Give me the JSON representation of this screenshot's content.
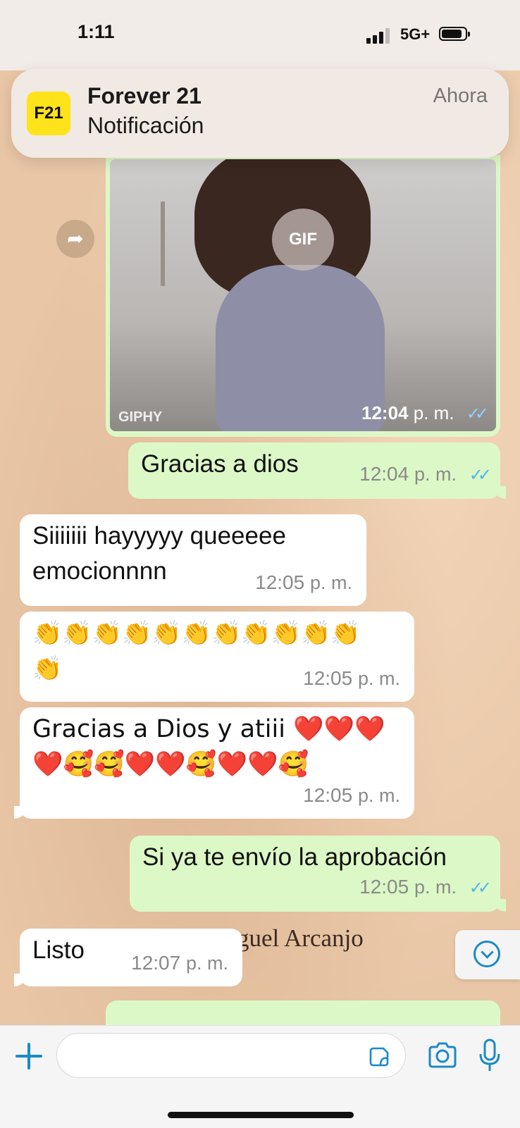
{
  "status": {
    "time": "1:11",
    "network": "5G+"
  },
  "notification": {
    "logo": "F21",
    "app": "Forever 21",
    "body": "Notificación",
    "time": "Ahora"
  },
  "gif": {
    "badge": "GIF",
    "watermark": "GIPHY",
    "time": "12:04",
    "ampm": "p. m."
  },
  "messages": [
    {
      "dir": "out",
      "text": "Gracias a dios",
      "time": "12:04",
      "ampm": "p. m.",
      "read": true
    },
    {
      "dir": "in",
      "lines": [
        "Siiiiiii hayyyyy queeeee",
        "emocionnnn"
      ],
      "time": "12:05",
      "ampm": "p. m."
    },
    {
      "dir": "in",
      "lines": [
        "👏👏👏👏👏👏👏👏👏👏👏",
        "👏"
      ],
      "time": "12:05",
      "ampm": "p. m."
    },
    {
      "dir": "in",
      "lines": [
        "Gracias a Dios y atiii ❤️❤️❤️",
        "❤️🥰🥰❤️❤️🥰❤️❤️🥰"
      ],
      "time": "12:05",
      "ampm": "p. m."
    },
    {
      "dir": "out",
      "text": "Si ya te envío la aprobación",
      "time": "12:05",
      "ampm": "p. m.",
      "read": true
    },
    {
      "dir": "in",
      "text": "Listo",
      "time": "12:07",
      "ampm": "p. m."
    }
  ],
  "wallpaper_text": "guel Arcanjo",
  "composer": {
    "placeholder": ""
  },
  "colors": {
    "out_bubble": "#dcf8c6",
    "in_bubble": "#ffffff",
    "accent": "#1b8ac6",
    "read_ticks": "#4fb6ec",
    "notif_logo": "#ffe31a"
  },
  "icons": [
    "forward-icon",
    "chevron-down-icon",
    "plus-icon",
    "sticker-icon",
    "camera-icon",
    "mic-icon",
    "signal-icon",
    "battery-icon"
  ]
}
